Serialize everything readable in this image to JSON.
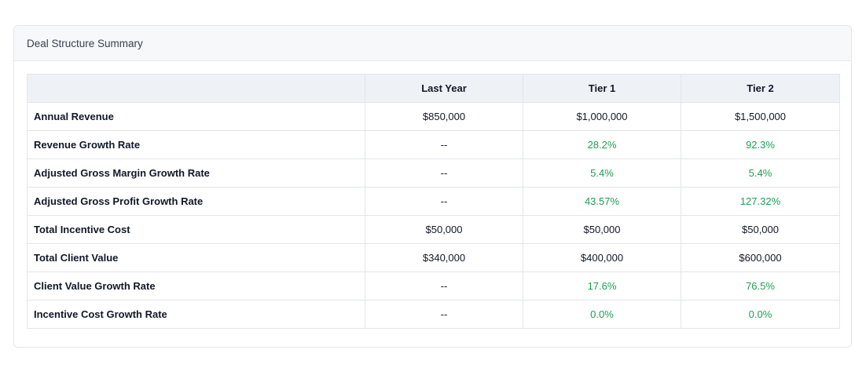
{
  "card": {
    "title": "Deal Structure Summary"
  },
  "table": {
    "columns": [
      "",
      "Last Year",
      "Tier 1",
      "Tier 2"
    ],
    "rows": [
      {
        "label": "Annual Revenue",
        "values": [
          "$850,000",
          "$1,000,000",
          "$1,500,000"
        ],
        "highlight": [
          false,
          false,
          false
        ]
      },
      {
        "label": "Revenue Growth Rate",
        "values": [
          "--",
          "28.2%",
          "92.3%"
        ],
        "highlight": [
          false,
          true,
          true
        ]
      },
      {
        "label": "Adjusted Gross Margin Growth Rate",
        "values": [
          "--",
          "5.4%",
          "5.4%"
        ],
        "highlight": [
          false,
          true,
          true
        ]
      },
      {
        "label": "Adjusted Gross Profit Growth Rate",
        "values": [
          "--",
          "43.57%",
          "127.32%"
        ],
        "highlight": [
          false,
          true,
          true
        ]
      },
      {
        "label": "Total Incentive Cost",
        "values": [
          "$50,000",
          "$50,000",
          "$50,000"
        ],
        "highlight": [
          false,
          false,
          false
        ]
      },
      {
        "label": "Total Client Value",
        "values": [
          "$340,000",
          "$400,000",
          "$600,000"
        ],
        "highlight": [
          false,
          false,
          false
        ]
      },
      {
        "label": "Client Value Growth Rate",
        "values": [
          "--",
          "17.6%",
          "76.5%"
        ],
        "highlight": [
          false,
          true,
          true
        ]
      },
      {
        "label": "Incentive Cost Growth Rate",
        "values": [
          "--",
          "0.0%",
          "0.0%"
        ],
        "highlight": [
          false,
          true,
          true
        ]
      }
    ]
  },
  "colors": {
    "positive": "#1f9d55",
    "header_bg": "#eef2f7"
  }
}
